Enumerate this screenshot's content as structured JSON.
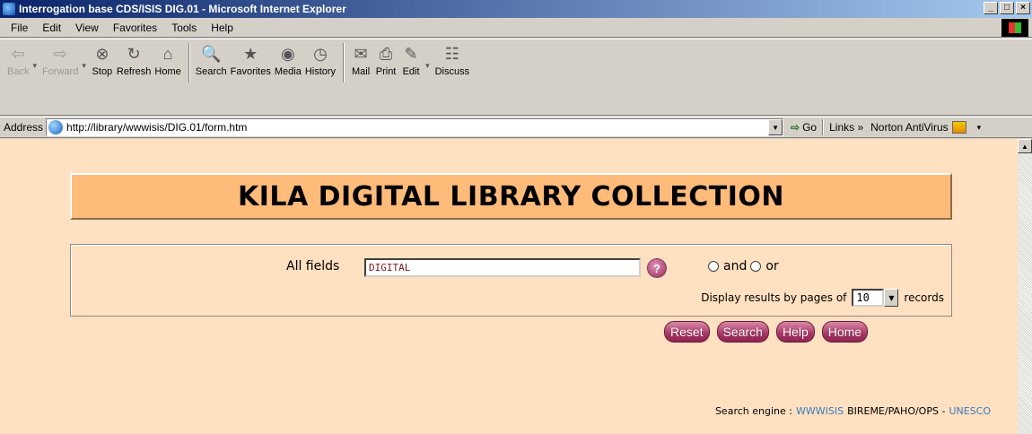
{
  "window": {
    "title": "Interrogation base CDS/ISIS DIG.01 - Microsoft Internet Explorer",
    "controls": [
      "_",
      "□",
      "×"
    ]
  },
  "menu": [
    "File",
    "Edit",
    "View",
    "Favorites",
    "Tools",
    "Help"
  ],
  "toolbar": {
    "back": "Back",
    "forward": "Forward",
    "stop": "Stop",
    "refresh": "Refresh",
    "home": "Home",
    "search": "Search",
    "favorites": "Favorites",
    "media": "Media",
    "history": "History",
    "mail": "Mail",
    "print": "Print",
    "edit": "Edit",
    "discuss": "Discuss"
  },
  "address": {
    "label": "Address",
    "url": "http://library/wwwisis/DIG.01/form.htm",
    "go": "Go",
    "links": "Links »",
    "norton": "Norton AntiVirus"
  },
  "page": {
    "banner_title": "KILA DIGITAL LIBRARY COLLECTION",
    "field_label": "All fields",
    "field_value": "DIGITAL",
    "help_symbol": "?",
    "radio_and": "and",
    "radio_or": "or",
    "display_prefix": "Display results by pages of",
    "display_value": "10",
    "display_suffix": "records",
    "buttons": {
      "reset": "Reset",
      "search": "Search",
      "help": "Help",
      "home": "Home"
    },
    "footer": {
      "prefix": "Search engine :",
      "wwwisis": "WWWISIS",
      "middle": "BIREME/PAHO/OPS -",
      "unesco": "UNESCO"
    }
  }
}
